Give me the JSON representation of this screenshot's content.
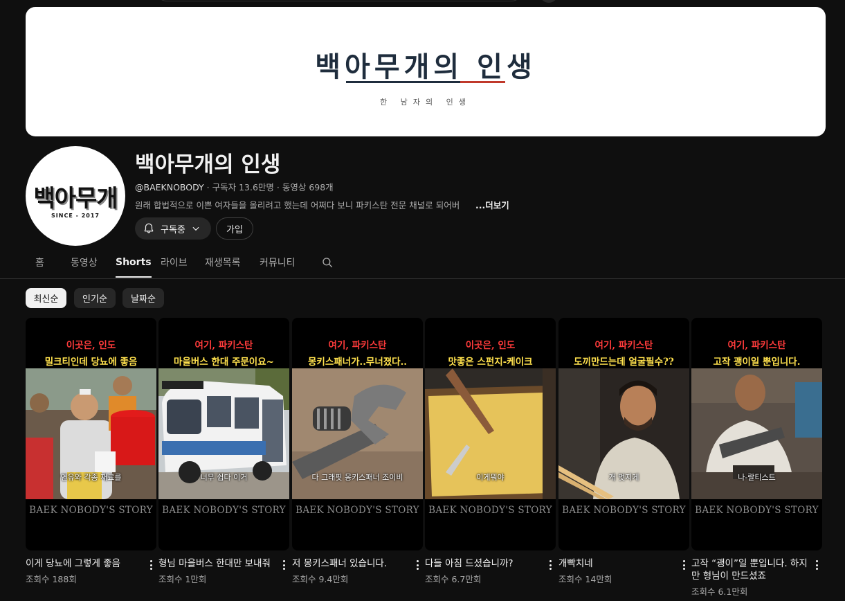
{
  "banner": {
    "title": "백아무개의 인생",
    "subtitle": "한 남자의 인생"
  },
  "channel": {
    "avatar_text": "백아무개",
    "avatar_since": "SINCE - 2017",
    "name": "백아무개의 인생",
    "handle": "@BAEKNOBODY",
    "subscribers": "구독자 13.6만명",
    "videos": "동영상 698개",
    "separator": " · ",
    "description": "원래 합법적으로 이쁜 여자들을 올리려고 했는데 어쩌다 보니 파키스탄 전문 채널로 되어버",
    "more_label": "...더보기",
    "subscribe_label": "구독중",
    "join_label": "가입"
  },
  "tabs": [
    {
      "label": "홈"
    },
    {
      "label": "동영상"
    },
    {
      "label": "Shorts",
      "active": true
    },
    {
      "label": "라이브"
    },
    {
      "label": "재생목록"
    },
    {
      "label": "커뮤니티"
    }
  ],
  "chips": [
    {
      "label": "최신순",
      "active": true
    },
    {
      "label": "인기순"
    },
    {
      "label": "날짜순"
    }
  ],
  "shorts": [
    {
      "overlay_red": "이곳은, 인도",
      "overlay_yellow": "밀크티인데 당뇨에 좋음",
      "caption": "연유와 각종 재료를",
      "story": "BAEK NOBODY'S STORY",
      "title": "이게 당뇨에 그렇게 좋음",
      "views": "조회수 188회"
    },
    {
      "overlay_red": "여기, 파키스탄",
      "overlay_yellow": "마을버스 한대 주문이요~",
      "caption": "너무 쉽다 이거",
      "story": "BAEK NOBODY'S STORY",
      "title": "형님 마을버스 한대만 보내줘",
      "views": "조회수 1만회"
    },
    {
      "overlay_red": "여기, 파키스탄",
      "overlay_yellow": "몽키스패너가..무너졌다..",
      "caption": "다 그래핏 몽키스패너 조이비",
      "story": "BAEK NOBODY'S STORY",
      "title": "저 몽키스패너 있습니다.",
      "views": "조회수 9.4만회"
    },
    {
      "overlay_red": "이곳은, 인도",
      "overlay_yellow": "맛좋은 스펀지-케이크",
      "caption": "이게뭐야",
      "story": "BAEK NOBODY'S STORY",
      "title": "다들 아침 드셨습니까?",
      "views": "조회수 6.7만회"
    },
    {
      "overlay_red": "여기, 파키스탄",
      "overlay_yellow": "도끼만드는데 얼굴필수??",
      "caption": "개 멋지게",
      "story": "BAEK NOBODY'S STORY",
      "title": "개빡치네",
      "views": "조회수 14만회"
    },
    {
      "overlay_red": "여기, 파키스탄",
      "overlay_yellow": "고작 괭이일 뿐입니다.",
      "caption": "나-랄티스트",
      "story": "BAEK NOBODY'S STORY",
      "title": "고작 “괭이”일 뿐입니다. 하지만 형님이 만드셨죠",
      "views": "조회수 6.1만회"
    }
  ],
  "icons": {
    "bell": "bell-icon",
    "chevron": "chevron-down-icon",
    "search": "search-icon",
    "more": "more-vert-icon"
  },
  "colors": {
    "background": "#0f0f0f",
    "overlay_red": "#ff3b3b",
    "overlay_yellow": "#ffe14d",
    "banner_navy": "#1f2d3d",
    "banner_red": "#c0392b"
  }
}
